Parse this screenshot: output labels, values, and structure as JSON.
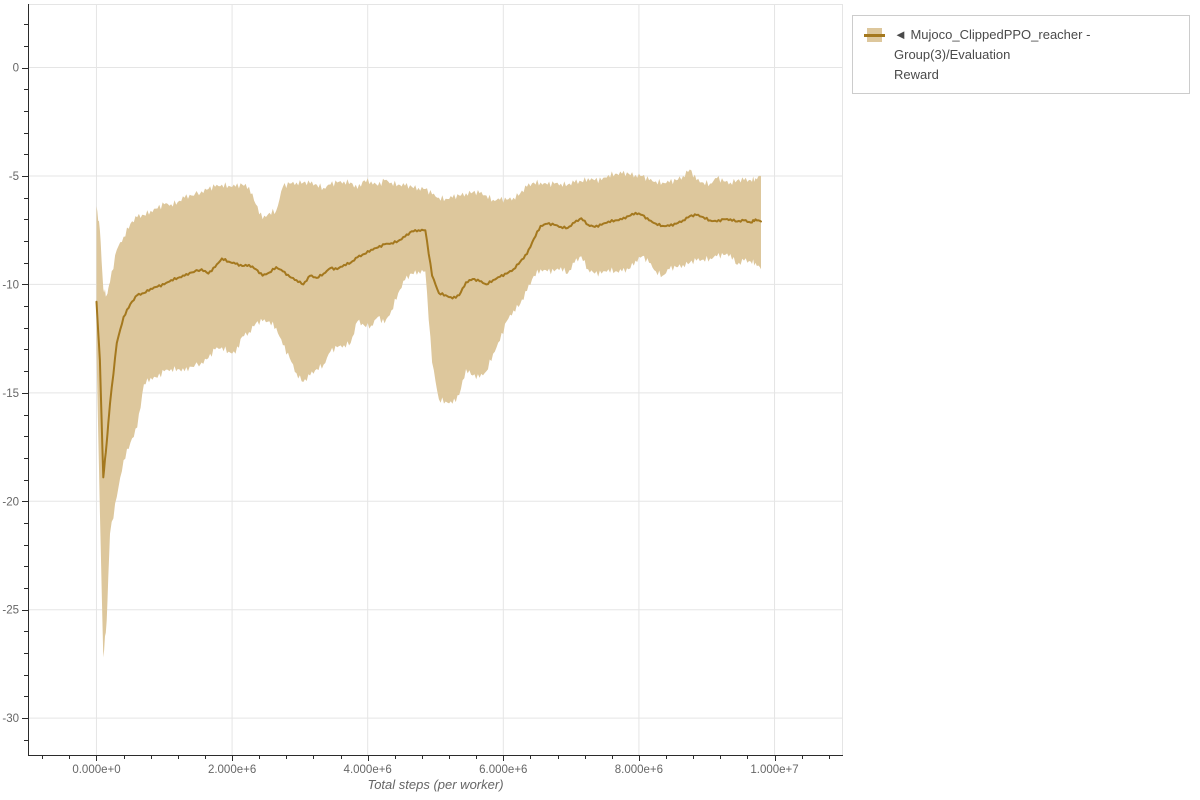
{
  "page": {
    "background": "#ffffff"
  },
  "colors": {
    "line": "#a4781e",
    "band": "#ddc79c",
    "grid": "#e5e5e5",
    "outline": "#e5e5e5",
    "axis": "#2b2b2b",
    "tick_label": "#666666",
    "axis_title": "#666666",
    "legend_text": "#4a4a4a",
    "legend_border": "#cccccc"
  },
  "legend": {
    "label_line1": "◄ Mujoco_ClippedPPO_reacher - Group(3)/Evaluation",
    "label_line2": "Reward",
    "marker": "band-with-line-swatch"
  },
  "chart_data": {
    "type": "line",
    "title": "",
    "xlabel": "Total steps (per worker)",
    "ylabel": "",
    "grid": true,
    "legend_position": "outside-top-right",
    "x_range": [
      -1010000,
      11010000
    ],
    "y_range": [
      -31.7,
      2.93
    ],
    "x_ticks": [
      {
        "value": 0,
        "label": "0.000e+0"
      },
      {
        "value": 2000000,
        "label": "2.000e+6"
      },
      {
        "value": 4000000,
        "label": "4.000e+6"
      },
      {
        "value": 6000000,
        "label": "6.000e+6"
      },
      {
        "value": 8000000,
        "label": "8.000e+6"
      },
      {
        "value": 10000000,
        "label": "1.000e+7"
      }
    ],
    "y_ticks": [
      {
        "value": 0,
        "label": "0"
      },
      {
        "value": -5,
        "label": "-5"
      },
      {
        "value": -10,
        "label": "-10"
      },
      {
        "value": -15,
        "label": "-15"
      },
      {
        "value": -20,
        "label": "-20"
      },
      {
        "value": -25,
        "label": "-25"
      },
      {
        "value": -30,
        "label": "-30"
      }
    ],
    "x_minor_step": 400000,
    "y_minor_step": 1,
    "series": [
      {
        "name": "Mujoco_ClippedPPO_reacher - Group(3)/Evaluation Reward",
        "color": "#a4781e",
        "band_color": "#ddc79c",
        "x": [
          0,
          50000,
          100000,
          150000,
          200000,
          300000,
          400000,
          500000,
          600000,
          700000,
          800000,
          900000,
          1000000,
          1100000,
          1200000,
          1300000,
          1400000,
          1550000,
          1650000,
          1750000,
          1850000,
          1950000,
          2050000,
          2150000,
          2250000,
          2350000,
          2450000,
          2550000,
          2650000,
          2750000,
          2850000,
          2950000,
          3050000,
          3150000,
          3250000,
          3350000,
          3450000,
          3550000,
          3650000,
          3750000,
          3850000,
          3950000,
          4050000,
          4150000,
          4250000,
          4350000,
          4450000,
          4550000,
          4650000,
          4750000,
          4850000,
          4950000,
          5050000,
          5150000,
          5250000,
          5350000,
          5450000,
          5550000,
          5650000,
          5750000,
          5850000,
          5950000,
          6050000,
          6150000,
          6250000,
          6350000,
          6450000,
          6550000,
          6650000,
          6750000,
          6850000,
          6950000,
          7050000,
          7150000,
          7250000,
          7350000,
          7450000,
          7550000,
          7650000,
          7750000,
          7850000,
          7950000,
          8050000,
          8150000,
          8250000,
          8350000,
          8450000,
          8550000,
          8650000,
          8750000,
          8850000,
          8950000,
          9050000,
          9150000,
          9250000,
          9350000,
          9450000,
          9550000,
          9650000,
          9720000,
          9800000
        ],
        "mean": [
          -10.8,
          -13.5,
          -18.9,
          -17.3,
          -15.5,
          -12.7,
          -11.5,
          -10.9,
          -10.5,
          -10.4,
          -10.2,
          -10.1,
          -10.0,
          -9.8,
          -9.7,
          -9.6,
          -9.45,
          -9.3,
          -9.5,
          -9.2,
          -8.8,
          -8.95,
          -9.05,
          -9.15,
          -9.1,
          -9.3,
          -9.6,
          -9.45,
          -9.2,
          -9.4,
          -9.65,
          -9.8,
          -10.0,
          -9.6,
          -9.7,
          -9.5,
          -9.25,
          -9.3,
          -9.1,
          -9.0,
          -8.75,
          -8.6,
          -8.4,
          -8.3,
          -8.15,
          -8.1,
          -8.0,
          -7.8,
          -7.55,
          -7.5,
          -7.5,
          -9.6,
          -10.4,
          -10.5,
          -10.65,
          -10.5,
          -9.9,
          -9.75,
          -9.85,
          -10.0,
          -9.8,
          -9.65,
          -9.5,
          -9.3,
          -8.95,
          -8.6,
          -7.9,
          -7.3,
          -7.2,
          -7.25,
          -7.35,
          -7.4,
          -7.15,
          -6.95,
          -7.25,
          -7.35,
          -7.25,
          -7.1,
          -7.05,
          -7.0,
          -6.85,
          -6.7,
          -6.8,
          -7.05,
          -7.2,
          -7.3,
          -7.3,
          -7.2,
          -7.05,
          -6.85,
          -6.8,
          -6.9,
          -7.05,
          -7.1,
          -7.0,
          -7.0,
          -7.1,
          -7.05,
          -7.15,
          -7.0,
          -7.1
        ],
        "band_high": [
          -6.4,
          -7.5,
          -10.2,
          -10.5,
          -9.9,
          -8.4,
          -7.8,
          -7.2,
          -6.9,
          -6.8,
          -6.6,
          -6.5,
          -6.3,
          -6.3,
          -6.2,
          -6.0,
          -5.9,
          -5.7,
          -5.6,
          -5.5,
          -5.4,
          -5.45,
          -5.5,
          -5.4,
          -5.5,
          -6.3,
          -7.0,
          -6.7,
          -6.6,
          -5.5,
          -5.35,
          -5.3,
          -5.3,
          -5.35,
          -5.4,
          -5.55,
          -5.4,
          -5.3,
          -5.25,
          -5.3,
          -5.6,
          -5.2,
          -5.25,
          -5.45,
          -5.2,
          -5.3,
          -5.4,
          -5.45,
          -5.5,
          -5.55,
          -5.6,
          -5.85,
          -6.0,
          -6.05,
          -6.0,
          -5.9,
          -5.8,
          -5.75,
          -5.8,
          -5.9,
          -6.1,
          -6.1,
          -6.1,
          -6.0,
          -5.8,
          -5.5,
          -5.3,
          -5.3,
          -5.4,
          -5.35,
          -5.35,
          -5.4,
          -5.3,
          -5.25,
          -5.1,
          -5.2,
          -5.2,
          -4.95,
          -4.9,
          -4.9,
          -4.9,
          -4.95,
          -5.0,
          -5.2,
          -5.25,
          -5.3,
          -5.3,
          -5.2,
          -5.0,
          -4.7,
          -5.2,
          -5.3,
          -5.35,
          -5.1,
          -5.25,
          -5.3,
          -5.2,
          -5.2,
          -5.2,
          -5.1,
          -5.0
        ],
        "band_low": [
          -13.0,
          -20.5,
          -27.2,
          -25.5,
          -21.5,
          -19.8,
          -18.1,
          -17.3,
          -16.6,
          -14.6,
          -14.3,
          -14.3,
          -14.0,
          -13.9,
          -13.9,
          -14.0,
          -13.8,
          -13.6,
          -13.4,
          -13.0,
          -12.9,
          -13.1,
          -13.2,
          -12.4,
          -12.2,
          -11.8,
          -11.7,
          -11.7,
          -12.0,
          -12.8,
          -13.4,
          -14.1,
          -14.5,
          -14.2,
          -13.9,
          -13.7,
          -13.1,
          -12.9,
          -12.8,
          -12.7,
          -11.7,
          -11.9,
          -11.9,
          -11.5,
          -11.8,
          -11.2,
          -10.4,
          -9.8,
          -9.5,
          -9.4,
          -9.4,
          -13.6,
          -15.3,
          -15.4,
          -15.5,
          -15.1,
          -13.9,
          -14.2,
          -14.3,
          -14.0,
          -13.2,
          -12.6,
          -11.7,
          -11.2,
          -10.9,
          -10.3,
          -9.6,
          -9.3,
          -9.4,
          -9.4,
          -9.2,
          -9.5,
          -9.0,
          -8.7,
          -9.3,
          -9.5,
          -9.5,
          -9.3,
          -9.4,
          -9.4,
          -9.3,
          -8.9,
          -8.7,
          -9.0,
          -9.4,
          -9.6,
          -9.3,
          -9.2,
          -9.1,
          -9.0,
          -8.9,
          -8.85,
          -8.8,
          -8.7,
          -8.65,
          -8.6,
          -9.1,
          -8.9,
          -8.95,
          -9.0,
          -9.3
        ]
      }
    ]
  }
}
